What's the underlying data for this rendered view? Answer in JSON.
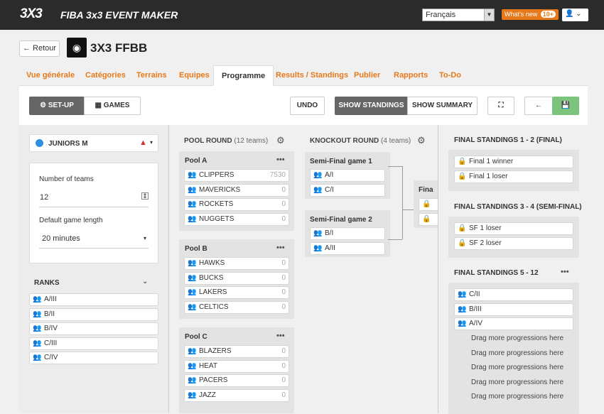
{
  "header": {
    "logo": "3X3",
    "brand": "FIBA 3x3 EVENT MAKER",
    "language": "Français",
    "whats_new": "What's new",
    "whats_new_badge": "10+"
  },
  "event": {
    "back": "Retour",
    "title": "3X3 FFBB"
  },
  "tabs": [
    "Vue générale",
    "Catégories",
    "Terrains",
    "Equipes",
    "Programme",
    "Results / Standings",
    "Publier",
    "Rapports",
    "To-Do"
  ],
  "toolbar": {
    "setup": "SET-UP",
    "games": "GAMES",
    "undo": "UNDO",
    "show_standings": "SHOW STANDINGS",
    "show_summary": "SHOW SUMMARY"
  },
  "category": {
    "name": "JUNIORS M",
    "num_teams_label": "Number of teams",
    "num_teams": "12",
    "game_length_label": "Default game length",
    "game_length": "20 minutes"
  },
  "ranks": {
    "title": "RANKS",
    "items": [
      "A/III",
      "B/II",
      "B/IV",
      "C/III",
      "C/IV"
    ]
  },
  "pool_round": {
    "title": "POOL ROUND",
    "count": "(12 teams)",
    "pools": [
      {
        "name": "Pool A",
        "teams": [
          {
            "n": "CLIPPERS",
            "s": "7530"
          },
          {
            "n": "MAVERICKS",
            "s": "0"
          },
          {
            "n": "ROCKETS",
            "s": "0"
          },
          {
            "n": "NUGGETS",
            "s": "0"
          }
        ]
      },
      {
        "name": "Pool B",
        "teams": [
          {
            "n": "HAWKS",
            "s": "0"
          },
          {
            "n": "BUCKS",
            "s": "0"
          },
          {
            "n": "LAKERS",
            "s": "0"
          },
          {
            "n": "CELTICS",
            "s": "0"
          }
        ]
      },
      {
        "name": "Pool C",
        "teams": [
          {
            "n": "BLAZERS",
            "s": "0"
          },
          {
            "n": "HEAT",
            "s": "0"
          },
          {
            "n": "PACERS",
            "s": "0"
          },
          {
            "n": "JAZZ",
            "s": "0"
          }
        ]
      }
    ]
  },
  "knockout": {
    "title": "KNOCKOUT ROUND",
    "count": "(4 teams)",
    "games": [
      {
        "name": "Semi-Final game 1",
        "slots": [
          "A/I",
          "C/I"
        ]
      },
      {
        "name": "Semi-Final game 2",
        "slots": [
          "B/I",
          "A/II"
        ]
      }
    ],
    "final_label": "Fina"
  },
  "standings": [
    {
      "title": "FINAL STANDINGS 1 - 2 (FINAL)",
      "items": [
        "Final 1 winner",
        "Final 1 loser"
      ]
    },
    {
      "title": "FINAL STANDINGS 3 - 4 (SEMI-FINAL)",
      "items": [
        "SF 1 loser",
        "SF 2 loser"
      ]
    },
    {
      "title": "FINAL STANDINGS 5 - 12",
      "items": [
        "C/II",
        "B/III",
        "A/IV"
      ]
    }
  ],
  "drag_text": "Drag more progressions here",
  "colors": {
    "accent": "#e8791a",
    "blue": "#2c8fe0",
    "green": "#7cc47c",
    "warning": "#d9302c"
  }
}
